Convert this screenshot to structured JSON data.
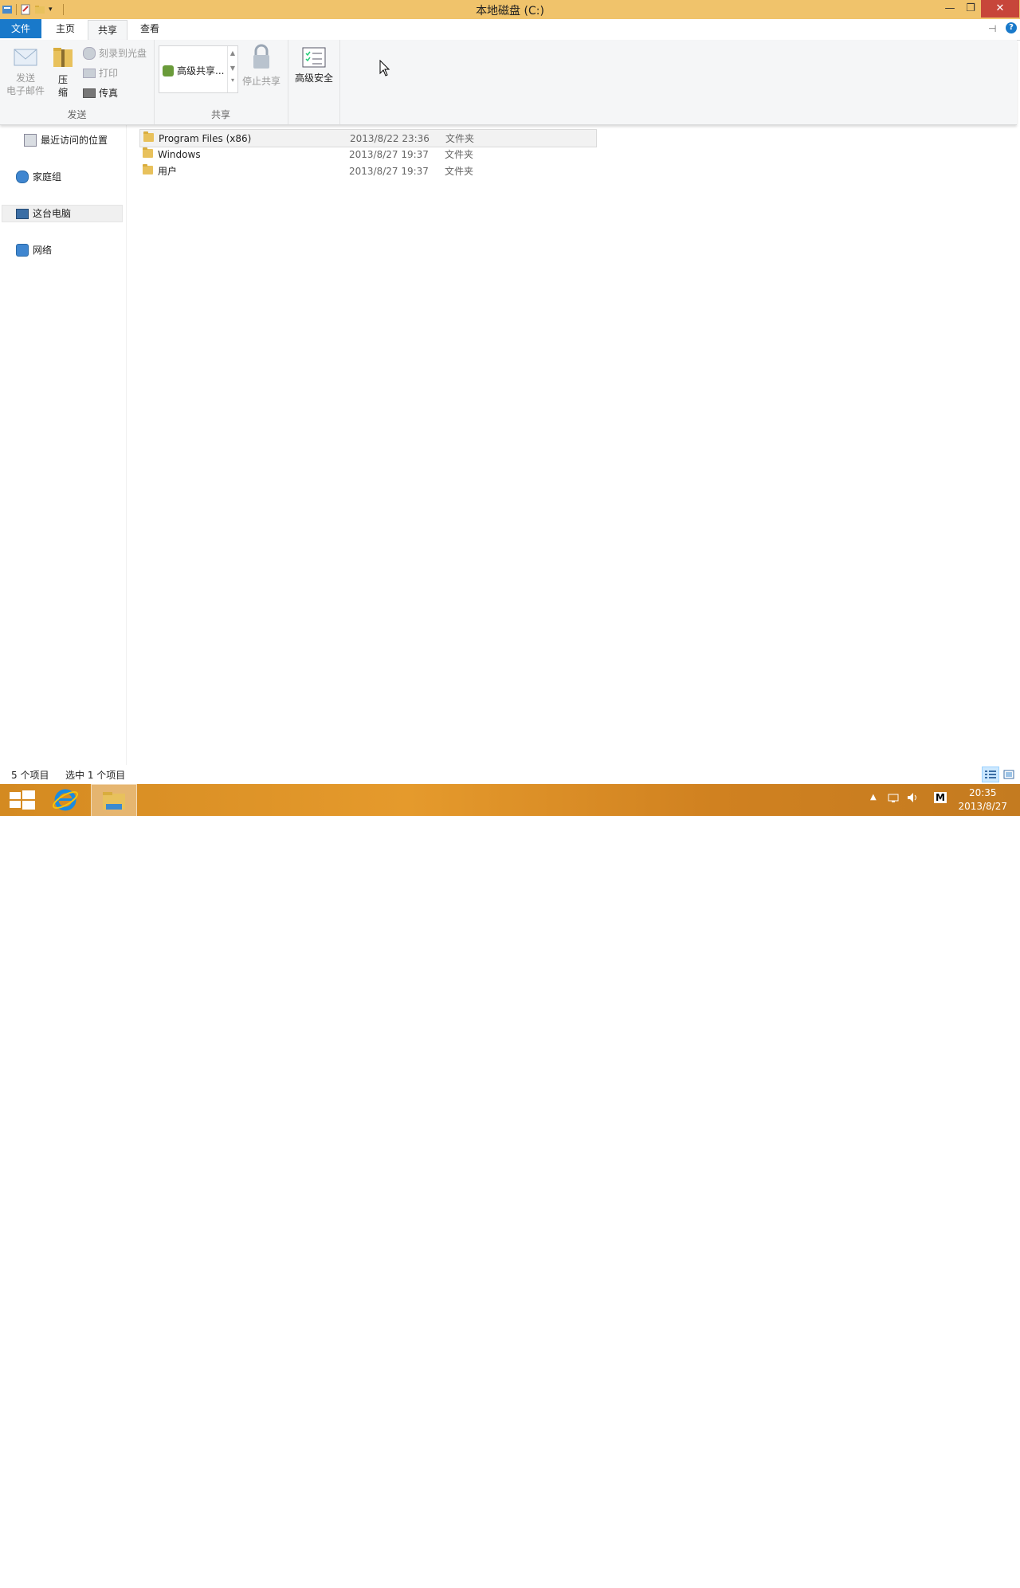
{
  "window": {
    "title": "本地磁盘 (C:)",
    "minimize": "—",
    "maximize": "❐",
    "close": "✕"
  },
  "tabs": {
    "file": "文件",
    "home": "主页",
    "share": "共享",
    "view": "查看"
  },
  "ribbon": {
    "send_group": {
      "label": "发送",
      "email_line1": "发送",
      "email_line2": "电子邮件",
      "zip_line1": "压",
      "zip_line2": "缩",
      "burn": "刻录到光盘",
      "print": "打印",
      "fax": "传真"
    },
    "share_group": {
      "label": "共享",
      "advanced_sharing": "高级共享...",
      "stop_sharing": "停止共享"
    },
    "security": {
      "advanced_security": "高级安全"
    }
  },
  "nav": {
    "recent_places": "最近访问的位置",
    "homegroup": "家庭组",
    "this_pc": "这台电脑",
    "network": "网络"
  },
  "files": [
    {
      "name": "Program Files (x86)",
      "date": "2013/8/22 23:36",
      "type": "文件夹"
    },
    {
      "name": "Windows",
      "date": "2013/8/27 19:37",
      "type": "文件夹"
    },
    {
      "name": "用户",
      "date": "2013/8/27 19:37",
      "type": "文件夹"
    }
  ],
  "status": {
    "item_count": "5 个项目",
    "selected": "选中 1 个项目"
  },
  "taskbar": {
    "time": "20:35",
    "date": "2013/8/27",
    "ime": "M"
  },
  "colors": {
    "titlebar": "#f0c36b",
    "file_tab": "#1979ca",
    "taskbar": "#d48a21"
  }
}
